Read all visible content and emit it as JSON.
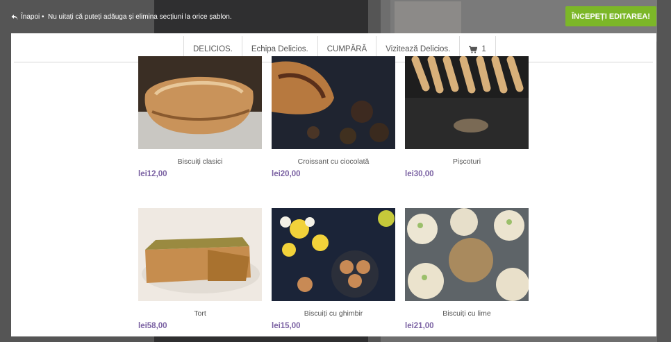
{
  "topbar": {
    "back_label": "Înapoi",
    "separator": "•",
    "notice": "Nu uitați că puteți adăuga și elimina secțiuni la orice șablon.",
    "start_button": "ÎNCEPEȚI EDITAREA!"
  },
  "nav": {
    "items": [
      {
        "label": "DELICIOS."
      },
      {
        "label": "Echipa Delicios."
      },
      {
        "label": "CUMPĂRĂ"
      },
      {
        "label": "Vizitează Delicios."
      }
    ],
    "cart_count": "1",
    "cart_icon": "shopping-cart-icon"
  },
  "products": [
    {
      "name": "Biscuiți clasici",
      "price": "lei12,00"
    },
    {
      "name": "Croissant cu ciocolată",
      "price": "lei20,00"
    },
    {
      "name": "Pișcoturi",
      "price": "lei30,00"
    },
    {
      "name": "Tort",
      "price": "lei58,00"
    },
    {
      "name": "Biscuiți cu ghimbir",
      "price": "lei15,00"
    },
    {
      "name": "Biscuiți cu lime",
      "price": "lei21,00"
    }
  ],
  "colors": {
    "accent_green": "#7cb728",
    "price_purple": "#7b62a3",
    "overlay": "#555555"
  }
}
